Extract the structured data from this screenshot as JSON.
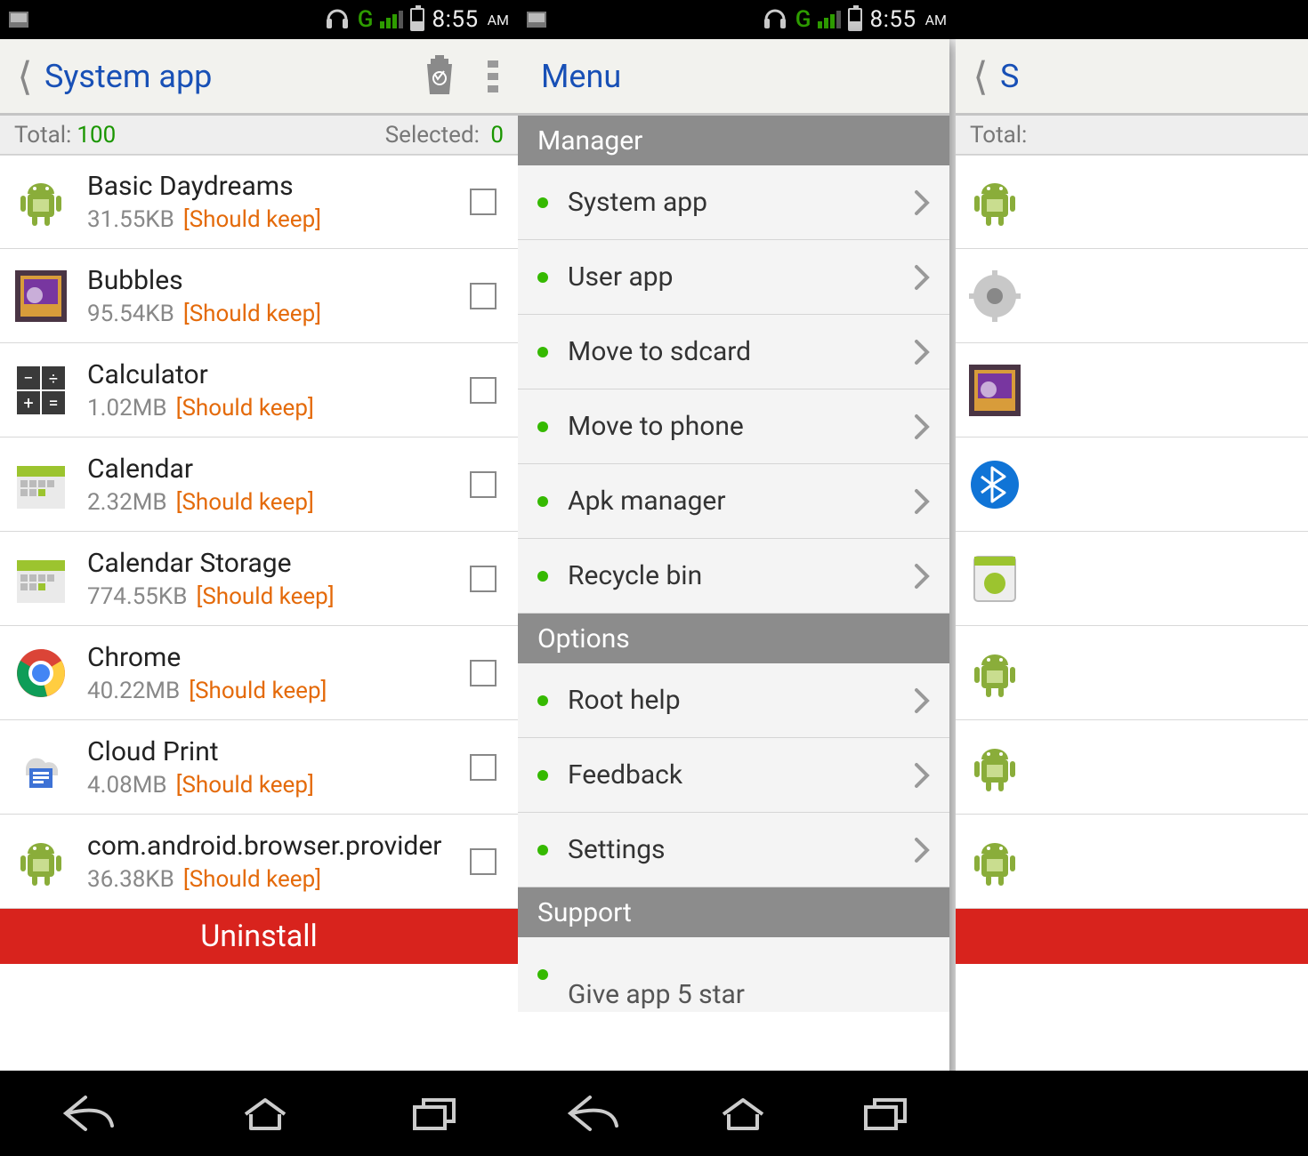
{
  "status": {
    "time": "8:55",
    "ampm": "AM",
    "net": "G"
  },
  "p1": {
    "title": "System app",
    "total_label": "Total:",
    "total": "100",
    "selected_label": "Selected:",
    "selected": "0",
    "apps": [
      {
        "name": "Basic Daydreams",
        "size": "31.55KB",
        "keep": "[Should keep]",
        "icon": "android"
      },
      {
        "name": "Bubbles",
        "size": "95.54KB",
        "keep": "[Should keep]",
        "icon": "bubbles"
      },
      {
        "name": "Calculator",
        "size": "1.02MB",
        "keep": "[Should keep]",
        "icon": "calculator"
      },
      {
        "name": "Calendar",
        "size": "2.32MB",
        "keep": "[Should keep]",
        "icon": "calendar"
      },
      {
        "name": "Calendar Storage",
        "size": "774.55KB",
        "keep": "[Should keep]",
        "icon": "calendar"
      },
      {
        "name": "Chrome",
        "size": "40.22MB",
        "keep": "[Should keep]",
        "icon": "chrome"
      },
      {
        "name": "Cloud Print",
        "size": "4.08MB",
        "keep": "[Should keep]",
        "icon": "cloudprint"
      },
      {
        "name": "com.android.browser.provider",
        "size": "36.38KB",
        "keep": "[Should keep]",
        "icon": "android"
      }
    ],
    "uninstall": "Uninstall"
  },
  "p2": {
    "title": "Menu",
    "sections": [
      {
        "header": "Manager",
        "items": [
          "System app",
          "User app",
          "Move to sdcard",
          "Move to phone",
          "Apk manager",
          "Recycle bin"
        ]
      },
      {
        "header": "Options",
        "items": [
          "Root help",
          "Feedback",
          "Settings"
        ]
      },
      {
        "header": "Support",
        "items_cut": "Give app 5 star"
      }
    ]
  },
  "p3": {
    "title_fragment": "S",
    "total_label": "Total:",
    "rows": [
      "android",
      "gear",
      "bubbles",
      "bluetooth",
      "apk",
      "android",
      "android",
      "android"
    ]
  }
}
